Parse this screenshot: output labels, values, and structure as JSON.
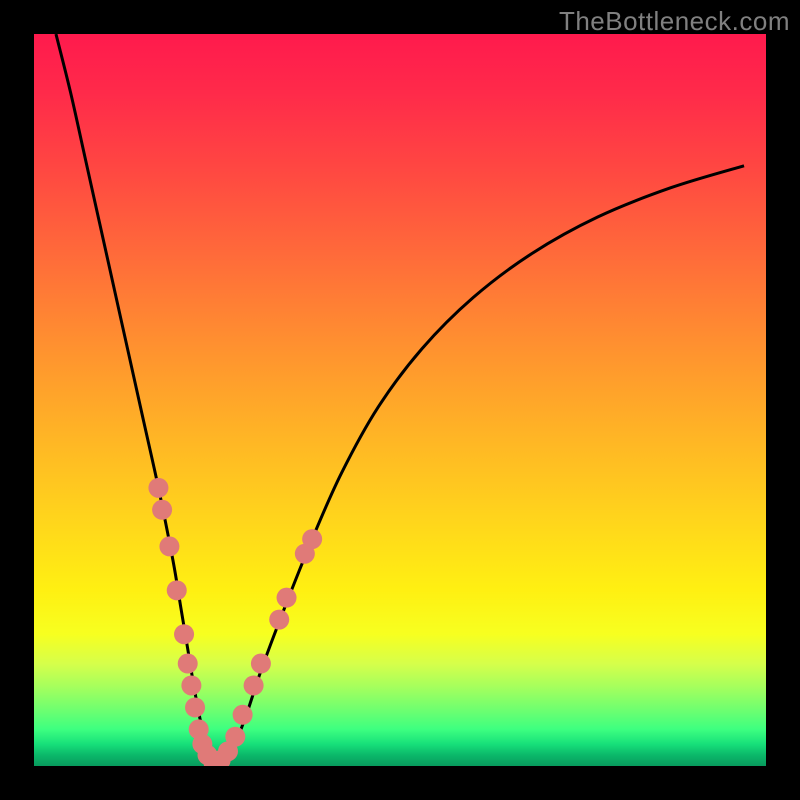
{
  "watermark": "TheBottleneck.com",
  "chart_data": {
    "type": "line",
    "title": "",
    "xlabel": "",
    "ylabel": "",
    "xlim": [
      0,
      100
    ],
    "ylim": [
      0,
      100
    ],
    "grid": false,
    "legend": false,
    "series": [
      {
        "name": "bottleneck-curve",
        "x": [
          3,
          5,
          7,
          9,
          11,
          13,
          15,
          17,
          19,
          20,
          21,
          22,
          23,
          24,
          25,
          27,
          29,
          31,
          34,
          38,
          42,
          47,
          53,
          60,
          68,
          77,
          87,
          97
        ],
        "y": [
          100,
          92,
          83,
          74,
          65,
          56,
          47,
          38,
          28,
          22,
          16,
          10,
          5,
          2,
          0,
          2,
          7,
          13,
          21,
          31,
          40,
          49,
          57,
          64,
          70,
          75,
          79,
          82
        ],
        "color": "#000000",
        "stroke_width": 3
      }
    ],
    "scatter": {
      "name": "sample-points",
      "color": "#e07a78",
      "radius": 10,
      "points": [
        {
          "x": 17.0,
          "y": 38
        },
        {
          "x": 17.5,
          "y": 35
        },
        {
          "x": 18.5,
          "y": 30
        },
        {
          "x": 19.5,
          "y": 24
        },
        {
          "x": 20.5,
          "y": 18
        },
        {
          "x": 21.0,
          "y": 14
        },
        {
          "x": 21.5,
          "y": 11
        },
        {
          "x": 22.0,
          "y": 8
        },
        {
          "x": 22.5,
          "y": 5
        },
        {
          "x": 23.0,
          "y": 3
        },
        {
          "x": 23.7,
          "y": 1.5
        },
        {
          "x": 24.5,
          "y": 0.5
        },
        {
          "x": 25.5,
          "y": 0.8
        },
        {
          "x": 26.5,
          "y": 2
        },
        {
          "x": 27.5,
          "y": 4
        },
        {
          "x": 28.5,
          "y": 7
        },
        {
          "x": 30.0,
          "y": 11
        },
        {
          "x": 31.0,
          "y": 14
        },
        {
          "x": 33.5,
          "y": 20
        },
        {
          "x": 34.5,
          "y": 23
        },
        {
          "x": 37.0,
          "y": 29
        },
        {
          "x": 38.0,
          "y": 31
        }
      ]
    }
  }
}
